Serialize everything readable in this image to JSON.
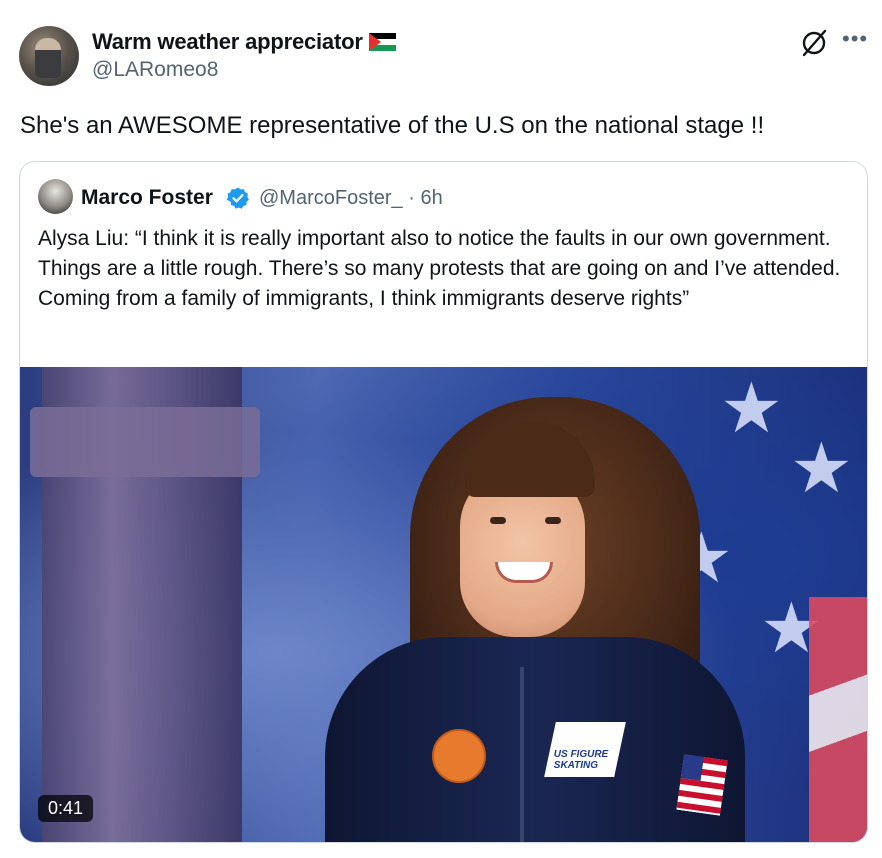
{
  "tweet": {
    "author_name": "Warm weather appreciator",
    "author_handle": "@LARomeo8",
    "text": "She's an AWESOME representative of the U.S on the national stage !!"
  },
  "quoted_tweet": {
    "author_name": "Marco Foster",
    "author_handle": "@MarcoFoster_",
    "time": "6h",
    "meta": "@MarcoFoster_ · 6h",
    "text": "Alysa Liu: “I think it is really important also to notice the faults in our own government. Things are a little rough. There’s so many protests that are going on and I’ve attended. Coming from a family of immigrants, I think immigrants deserve rights”",
    "media": {
      "duration": "0:41",
      "patch_text": "US FIGURE SKATING"
    }
  },
  "icons": {
    "flag": "palestine-flag-icon",
    "grok": "grok-icon",
    "more": "more-icon",
    "verified": "verified-badge-icon"
  },
  "colors": {
    "text": "#0f1419",
    "secondary": "#536471",
    "verified": "#1d9bf0",
    "border": "#cfd9de"
  }
}
